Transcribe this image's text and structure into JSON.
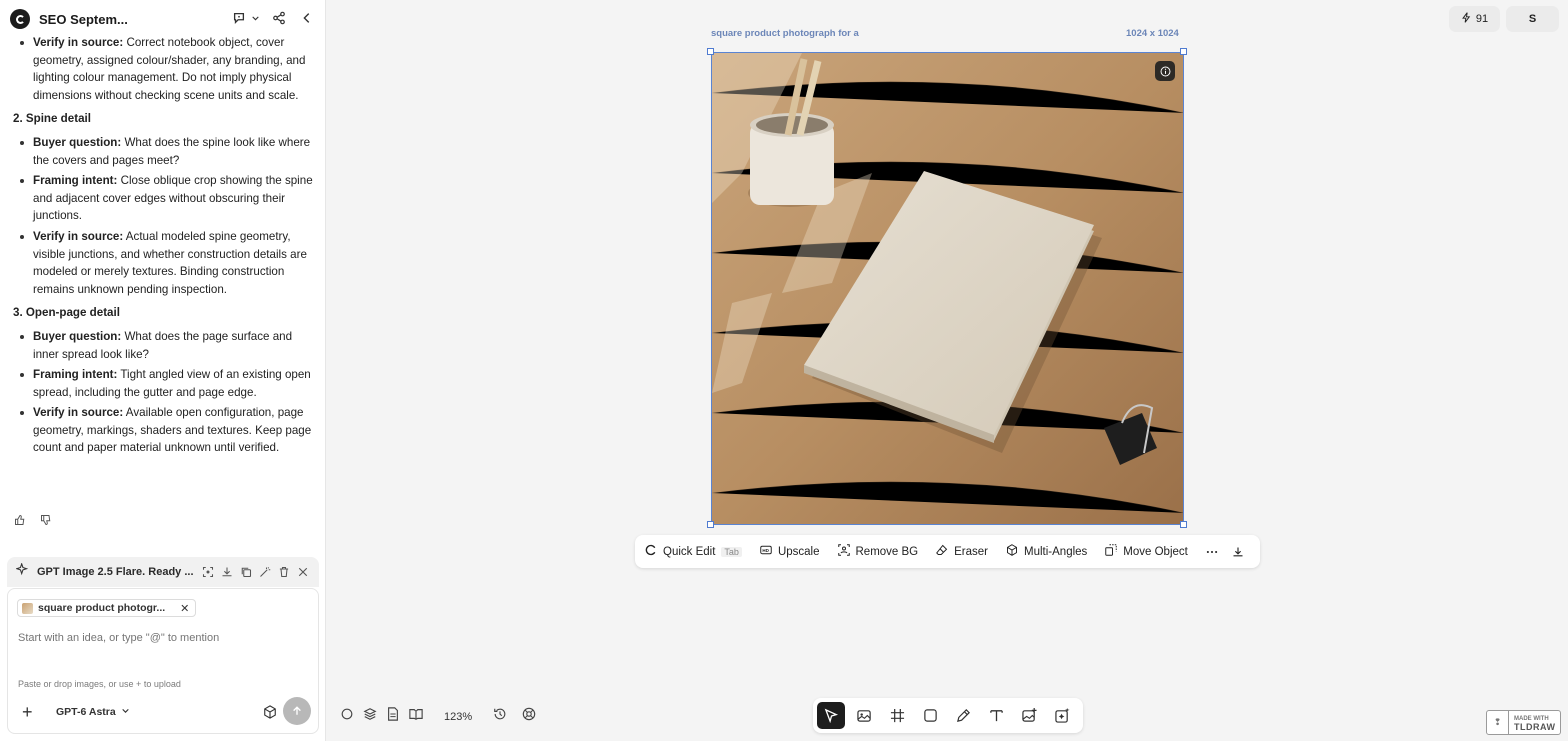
{
  "sidebar": {
    "title": "SEO Septem...",
    "icons": [
      "chat-bubble-icon",
      "chevron-down-icon",
      "share-icon",
      "collapse-left-icon"
    ],
    "sections": [
      {
        "intro_item": {
          "label": "Verify in source:",
          "text": " Correct notebook object, cover geometry, assigned colour/shader, any branding, and lighting colour management. Do not imply physical dimensions without checking scene units and scale."
        }
      },
      {
        "heading": "2. Spine detail",
        "items": [
          {
            "label": "Buyer question:",
            "text": " What does the spine look like where the covers and pages meet?"
          },
          {
            "label": "Framing intent:",
            "text": " Close oblique crop showing the spine and adjacent cover edges without obscuring their junctions."
          },
          {
            "label": "Verify in source:",
            "text": " Actual modeled spine geometry, visible junctions, and whether construction details are modeled or merely textures. Binding construction remains unknown pending inspection."
          }
        ]
      },
      {
        "heading": "3. Open-page detail",
        "items": [
          {
            "label": "Buyer question:",
            "text": " What does the page surface and inner spread look like?"
          },
          {
            "label": "Framing intent:",
            "text": " Tight angled view of an existing open spread, including the gutter and page edge."
          },
          {
            "label": "Verify in source:",
            "text": " Available open configuration, page geometry, markings, shaders and textures. Keep page count and paper material unknown until verified."
          }
        ]
      }
    ],
    "generation_bar": {
      "title": "GPT Image 2.5 Flare. Ready ...",
      "icons": [
        "focus-icon",
        "download-icon",
        "copy-icon",
        "magic-wand-icon",
        "trash-icon",
        "close-icon"
      ]
    },
    "composer": {
      "chip_label": "square product photogr...",
      "placeholder": "Start with an idea, or type \"@\" to mention",
      "hint": "Paste or drop images, or use + to upload",
      "plus": "+",
      "model": "GPT-6 Astra"
    }
  },
  "canvas": {
    "frame_label": "square product photograph for a",
    "frame_dims": "1024 x 1024",
    "toolbar": {
      "quick_edit": "Quick Edit",
      "quick_edit_key": "Tab",
      "upscale": "Upscale",
      "remove_bg": "Remove BG",
      "eraser": "Eraser",
      "multi_angles": "Multi-Angles",
      "move_object": "Move Object"
    },
    "zoom": "123%"
  },
  "topbar": {
    "credits": "91",
    "avatar": "S"
  },
  "watermark": {
    "made_with": "MADE WITH",
    "name": "TLDRAW"
  },
  "colors": {
    "selection": "#5a84d2",
    "frame_label": "#6c86b8",
    "active_tool": "#1d1d1d"
  }
}
